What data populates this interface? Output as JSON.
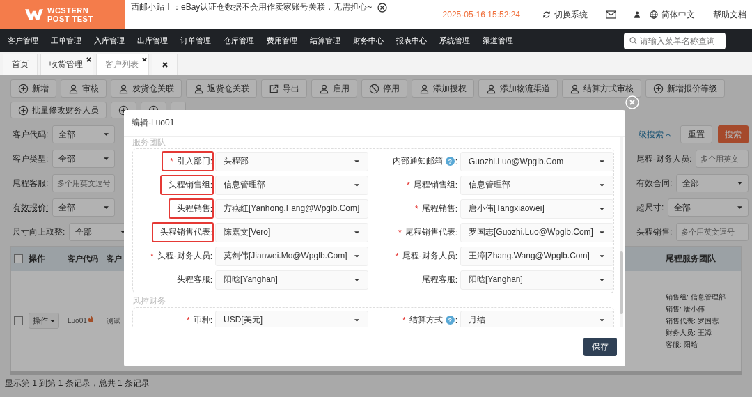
{
  "header": {
    "logo": [
      "WCSTERN",
      "POST TEST"
    ],
    "notice": "西邮小贴士：eBay认证仓数据不会用作卖家账号关联，无需担心~",
    "datetime": "2025-05-16 15:52:24",
    "switch_system": "切换系统",
    "language": "简体中文",
    "help": "帮助文档"
  },
  "nav": {
    "items": [
      "客户管理",
      "工单管理",
      "入库管理",
      "出库管理",
      "订单管理",
      "仓库管理",
      "费用管理",
      "结算管理",
      "财务中心",
      "报表中心",
      "系统管理",
      "渠道管理"
    ],
    "search_placeholder": "请输入菜单名称查询"
  },
  "tabs": [
    {
      "kind": "page",
      "label": "首页",
      "closable": false,
      "selected": false
    },
    {
      "kind": "page",
      "label": "收货管理",
      "closable": true,
      "selected": false
    },
    {
      "kind": "page",
      "label": "客户列表",
      "closable": true,
      "selected": true
    },
    {
      "kind": "close-all"
    }
  ],
  "toolbar": [
    [
      {
        "label": "新增",
        "kind": "add"
      },
      {
        "label": "审核",
        "kind": "user"
      },
      {
        "label": "发货仓关联",
        "kind": "user"
      },
      {
        "label": "退货仓关联",
        "kind": "user"
      },
      {
        "label": "导出",
        "kind": "export"
      },
      {
        "label": "启用",
        "kind": "user"
      },
      {
        "label": "停用",
        "kind": "ban"
      },
      {
        "label": "添加授权",
        "kind": "user"
      },
      {
        "label": "添加物流渠道",
        "kind": "user"
      },
      {
        "label": "结算方式审核",
        "kind": "user"
      },
      {
        "label": "新增报价等级",
        "kind": "add"
      }
    ],
    [
      {
        "label": "批量修改财务人员",
        "kind": "add"
      },
      {
        "kind": "add"
      },
      {
        "kind": "add"
      },
      {
        "kind": "none"
      }
    ]
  ],
  "filters_left": [
    {
      "label": "客户代码:",
      "kind": "select",
      "value": "全部",
      "tooltip": false
    },
    {
      "label": "客户类型:",
      "kind": "select",
      "value": "全部",
      "tooltip": false
    },
    {
      "label": "尾程客服:",
      "kind": "input",
      "placeholder": "多个用英文逗号",
      "tooltip": false
    },
    {
      "label": "有效报价:",
      "kind": "select",
      "value": "全部",
      "tooltip": true
    },
    {
      "label": "尺寸向上取整:",
      "kind": "select",
      "value": "全部",
      "tooltip": false
    }
  ],
  "search_actions": {
    "advanced": "级搜索",
    "reset": "重置",
    "search": "搜索"
  },
  "filters_right": [
    {
      "label": "尾程-财务人员:",
      "kind": "input",
      "placeholder": "多个用英文",
      "tooltip": false
    },
    {
      "label": "有效合同:",
      "kind": "select",
      "value": "全部",
      "tooltip": true
    },
    {
      "label": "超尺寸:",
      "kind": "select",
      "value": "全部",
      "tooltip": false
    },
    {
      "label": "头程销售:",
      "kind": "input",
      "placeholder": "多个用英文逗号",
      "tooltip": false
    }
  ],
  "table": {
    "all_checked": false,
    "columns": [
      "操作",
      "客户代码",
      "客户",
      "尾程服务团队"
    ],
    "rows": [
      {
        "checked": false,
        "action": "操作",
        "code": "Luo01",
        "name": "测试",
        "team": [
          "销售组: 信息管理部",
          "销售: 唐小伟",
          "销售代表: 罗国志",
          "财务人员: 王漳",
          "客服: 阳晗"
        ]
      }
    ]
  },
  "pagination": "显示第 1 到第 1 条记录，总共 1 条记录",
  "modal": {
    "title": "编辑-Luo01",
    "save": "保存",
    "sections": [
      {
        "title": "服务团队",
        "fields": [
          {
            "required": "*",
            "label": "引入部门",
            "colon": ":",
            "highlighted": true,
            "value": "头程部"
          },
          {
            "label": "内部通知邮箱",
            "help": "?",
            "colon": ":",
            "highlighted": false,
            "value": "Guozhi.Luo@Wpglb.Com"
          },
          {
            "label": "头程销售组",
            "colon": ":",
            "highlighted": true,
            "value": "信息管理部"
          },
          {
            "required": "*",
            "label": "尾程销售组",
            "colon": ":",
            "highlighted": false,
            "value": "信息管理部"
          },
          {
            "label": "头程销售",
            "colon": ":",
            "highlighted": true,
            "value": "方燕红[Yanhong.Fang@Wpglb.Com]"
          },
          {
            "required": "*",
            "label": "尾程销售",
            "colon": ":",
            "highlighted": false,
            "value": "唐小伟[Tangxiaowei]"
          },
          {
            "label": "头程销售代表",
            "colon": ":",
            "highlighted": true,
            "value": "陈嘉文[Vero]"
          },
          {
            "required": "*",
            "label": "尾程销售代表",
            "colon": ":",
            "highlighted": false,
            "value": "罗国志[Guozhi.Luo@Wpglb.Com]"
          },
          {
            "required": "*",
            "label": "头程-财务人员",
            "colon": ":",
            "highlighted": false,
            "value": "莫剑伟[Jianwei.Mo@Wpglb.Com]"
          },
          {
            "required": "*",
            "label": "尾程-财务人员",
            "colon": ":",
            "highlighted": false,
            "value": "王漳[Zhang.Wang@Wpglb.Com]"
          },
          {
            "label": "头程客服",
            "colon": ":",
            "highlighted": false,
            "value": "阳晗[Yanghan]"
          },
          {
            "label": "尾程客服",
            "colon": ":",
            "highlighted": false,
            "value": "阳晗[Yanghan]"
          }
        ]
      },
      {
        "title": "风控财务",
        "fields": [
          {
            "required": "*",
            "label": "币种",
            "colon": ":",
            "highlighted": false,
            "value": "USD[美元]"
          },
          {
            "required": "*",
            "label": "结算方式",
            "help": "?",
            "colon": ":",
            "highlighted": false,
            "value": "月结"
          }
        ]
      }
    ]
  }
}
